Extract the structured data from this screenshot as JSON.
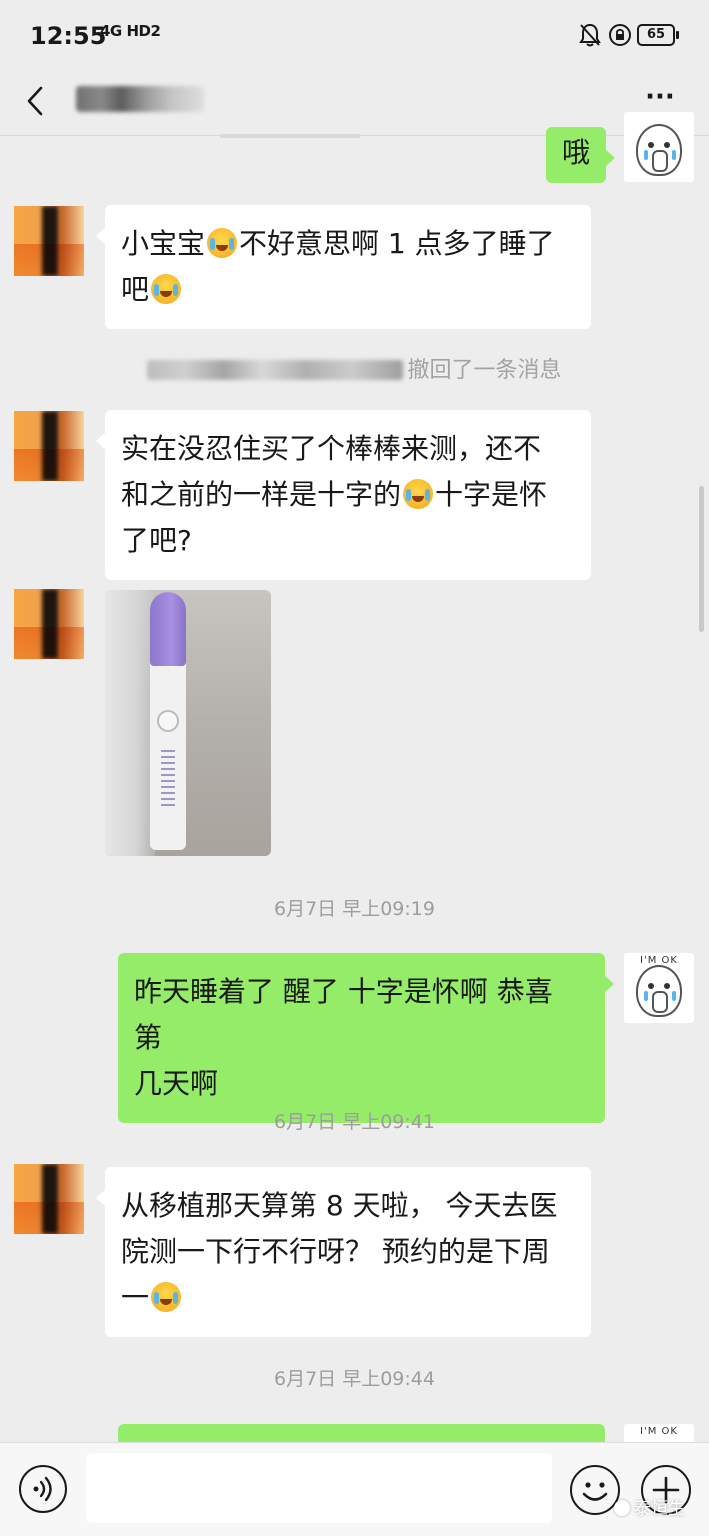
{
  "status_bar": {
    "time": "12:55",
    "network": "4G HD2",
    "battery": "65",
    "icons": [
      "signal-icon",
      "mute-bell-icon",
      "rotation-lock-icon",
      "battery-icon"
    ]
  },
  "nav": {
    "back_icon": "chevron-left-icon",
    "more_label": "···"
  },
  "messages": [
    {
      "side": "out",
      "text": "哦"
    },
    {
      "side": "in",
      "text_parts": [
        "小宝宝",
        "emoji",
        "不好意思啊 1 点多了睡了",
        "br",
        "吧",
        "emoji"
      ]
    },
    {
      "type": "recall",
      "text": "撤回了一条消息"
    },
    {
      "side": "in",
      "text_parts": [
        "实在没忍住买了个棒棒来测，还不",
        "br",
        "和之前的一样是十字的",
        "emoji",
        "十字是怀",
        "br",
        "了吧?"
      ]
    },
    {
      "side": "in",
      "type": "image",
      "alt": "pregnancy-test-photo"
    },
    {
      "type": "time",
      "text": "6月7日 早上09:19"
    },
    {
      "side": "out",
      "text_parts": [
        "昨天睡着了 醒了 十字是怀啊 恭喜 第",
        "br",
        "几天啊"
      ]
    },
    {
      "type": "time",
      "text": "6月7日 早上09:41"
    },
    {
      "side": "in",
      "text_parts": [
        "从移植那天算第 8 天啦， 今天去医",
        "br",
        "院测一下行不行呀？ 预约的是下周",
        "br",
        "一",
        "emoji"
      ]
    },
    {
      "type": "time",
      "text": "6月7日 早上09:44"
    }
  ],
  "sticker_caption": "I'M OK",
  "ts": {
    "t1": "6月7日 早上09:19",
    "t2": "6月7日 早上09:41",
    "t3": "6月7日 早上09:44"
  },
  "recall_text": "撤回了一条消息",
  "bubbles": {
    "b0": "哦",
    "b1a": "小宝宝",
    "b1b": "不好意思啊 1 点多了睡了",
    "b1c": "吧",
    "b2a": "实在没忍住买了个棒棒来测，还不",
    "b2b": "和之前的一样是十字的",
    "b2c": "十字是怀",
    "b2d": "了吧?",
    "b3a": "昨天睡着了 醒了 十字是怀啊 恭喜 第",
    "b3b": "几天啊",
    "b4a": "从移植那天算第 8 天啦， 今天去医",
    "b4b": "院测一下行不行呀？ 预约的是下周",
    "b4c": "一"
  },
  "input_bar": {
    "voice_icon": "voice-icon",
    "emoji_icon": "smiley-icon",
    "plus_icon": "plus-icon",
    "placeholder": ""
  },
  "watermark": "泰恒生",
  "colors": {
    "background": "#ededed",
    "bubble_out": "#95ec69",
    "bubble_in": "#ffffff",
    "timestamp": "#9d9d9d"
  }
}
